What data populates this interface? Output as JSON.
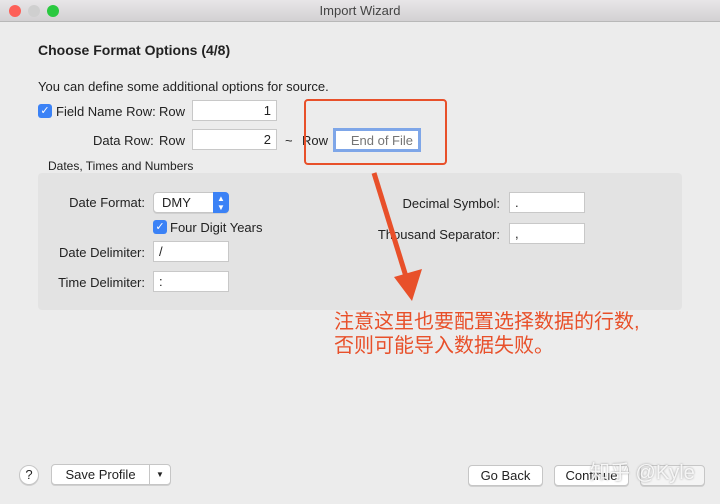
{
  "window": {
    "title": "Import Wizard"
  },
  "header": {
    "title": "Choose Format Options (4/8)",
    "description": "You can define some additional options for source."
  },
  "rows": {
    "field_name_label": "Field Name Row:",
    "field_name_checked": true,
    "row_label": "Row",
    "field_name_value": "1",
    "data_row_label": "Data Row:",
    "data_row_value": "2",
    "tilde": "~",
    "end_row_placeholder": "End of File"
  },
  "dates": {
    "group_title": "Dates, Times and Numbers",
    "date_format_label": "Date Format:",
    "date_format_value": "DMY",
    "four_digit_label": "Four Digit Years",
    "four_digit_checked": true,
    "date_delimiter_label": "Date Delimiter:",
    "date_delimiter_value": "/",
    "time_delimiter_label": "Time Delimiter:",
    "time_delimiter_value": ":",
    "decimal_label": "Decimal Symbol:",
    "decimal_value": ".",
    "thousand_label": "Thousand Separator:",
    "thousand_value": ","
  },
  "annotation": {
    "line1": "注意这里也要配置选择数据的行数,",
    "line2": "否则可能导入数据失败。",
    "color": "#e8502a"
  },
  "footer": {
    "help": "?",
    "save_profile": "Save Profile",
    "go_back": "Go Back",
    "continue": "Continue"
  },
  "watermark": "知乎 @Kyle"
}
